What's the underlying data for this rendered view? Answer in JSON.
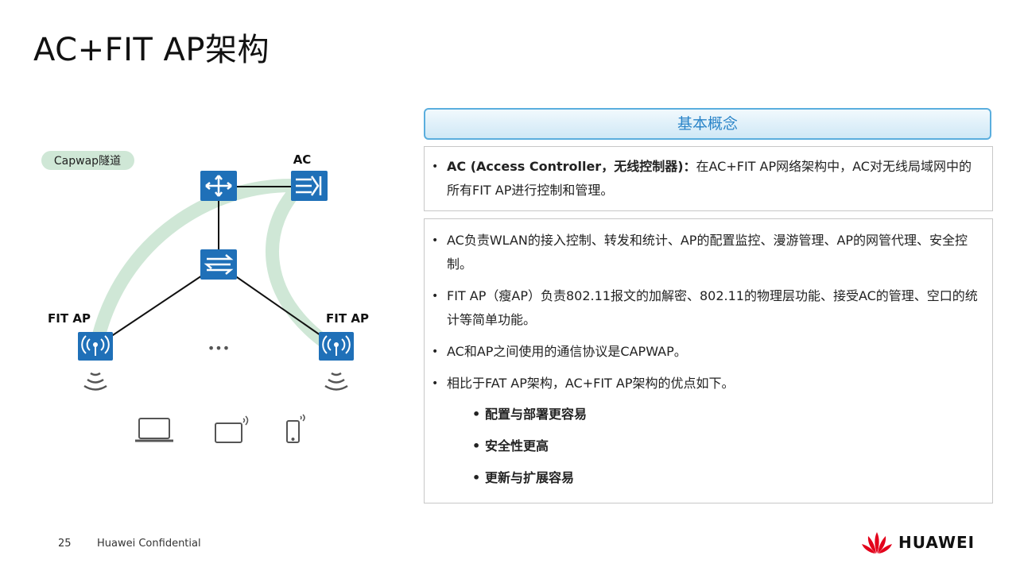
{
  "title": "AC+FIT AP架构",
  "diagram": {
    "tunnel_label": "Capwap隧道",
    "ac_label": "AC",
    "fit_ap_left_label": "FIT AP",
    "fit_ap_right_label": "FIT AP",
    "ellipsis": "•••"
  },
  "concept": {
    "header": "基本概念",
    "ac_definition_bold": "AC (Access Controller，无线控制器)：",
    "ac_definition_rest": "在AC+FIT AP网络架构中，AC对无线局域网中的所有FIT AP进行控制和管理。",
    "bullets": [
      "AC负责WLAN的接入控制、转发和统计、AP的配置监控、漫游管理、AP的网管代理、安全控制。",
      "FIT AP（瘦AP）负责802.11报文的加解密、802.11的物理层功能、接受AC的管理、空口的统计等简单功能。",
      "AC和AP之间使用的通信协议是CAPWAP。",
      "相比于FAT AP架构，AC+FIT AP架构的优点如下。"
    ],
    "advantages": [
      "配置与部署更容易",
      "安全性更高",
      "更新与扩展容易"
    ]
  },
  "footer": {
    "page_number": "25",
    "confidential": "Huawei Confidential",
    "brand": "HUAWEI"
  },
  "colors": {
    "device_blue": "#1f70b8",
    "tunnel_green": "#cfe7d6",
    "header_blue": "#2a84c8",
    "logo_red": "#e3001b"
  }
}
